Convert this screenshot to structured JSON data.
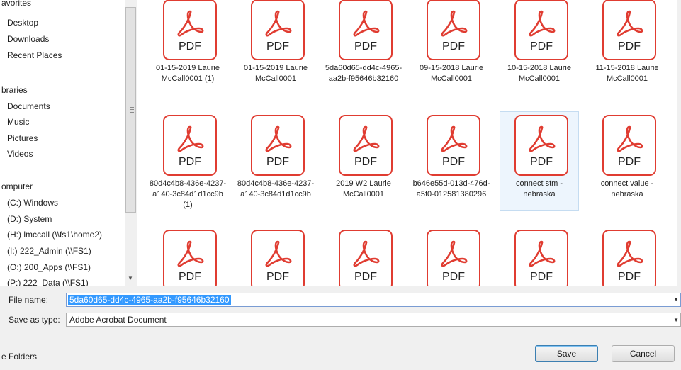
{
  "nav": {
    "items": [
      {
        "label": "avorites",
        "top": 0
      },
      {
        "label": "Desktop"
      },
      {
        "label": "Downloads"
      },
      {
        "label": "Recent Places"
      },
      {
        "label": "braries"
      },
      {
        "label": "Documents"
      },
      {
        "label": "Music"
      },
      {
        "label": "Pictures"
      },
      {
        "label": "Videos"
      },
      {
        "label": "omputer"
      },
      {
        "label": "(C:) Windows"
      },
      {
        "label": "(D:) System"
      },
      {
        "label": "(H:) lmccall (\\\\fs1\\home2)"
      },
      {
        "label": "(I:) 222_Admin (\\\\FS1)"
      },
      {
        "label": "(O:) 200_Apps (\\\\FS1)"
      },
      {
        "label": "(P:) 222_Data (\\\\FS1)"
      }
    ]
  },
  "files": {
    "icon_label": "PDF",
    "items": [
      {
        "name": "01-15-2019 Laurie McCall0001 (1)"
      },
      {
        "name": "01-15-2019 Laurie McCall0001"
      },
      {
        "name": "5da60d65-dd4c-4965-aa2b-f95646b32160"
      },
      {
        "name": "09-15-2018 Laurie McCall0001"
      },
      {
        "name": "10-15-2018 Laurie McCall0001"
      },
      {
        "name": "11-15-2018 Laurie McCall0001"
      },
      {
        "name": "80d4c4b8-436e-4237-a140-3c84d1d1cc9b (1)"
      },
      {
        "name": "80d4c4b8-436e-4237-a140-3c84d1d1cc9b"
      },
      {
        "name": "2019 W2 Laurie McCall0001"
      },
      {
        "name": "b646e55d-013d-476d-a5f0-012581380296"
      },
      {
        "name": "connect stm - nebraska",
        "selected": true
      },
      {
        "name": "connect value - nebraska"
      },
      {
        "name": ""
      },
      {
        "name": ""
      },
      {
        "name": ""
      },
      {
        "name": ""
      },
      {
        "name": ""
      },
      {
        "name": ""
      }
    ]
  },
  "form": {
    "filename_label": "File name:",
    "filename_value": "5da60d65-dd4c-4965-aa2b-f95646b32160",
    "savetype_label": "Save as type:",
    "savetype_value": "Adobe Acrobat Document"
  },
  "buttons": {
    "save": "Save",
    "cancel": "Cancel"
  },
  "footer": {
    "hide_folders": "e Folders"
  },
  "colors": {
    "pdf_red": "#e03c31",
    "selection_blue": "#3399ff"
  }
}
